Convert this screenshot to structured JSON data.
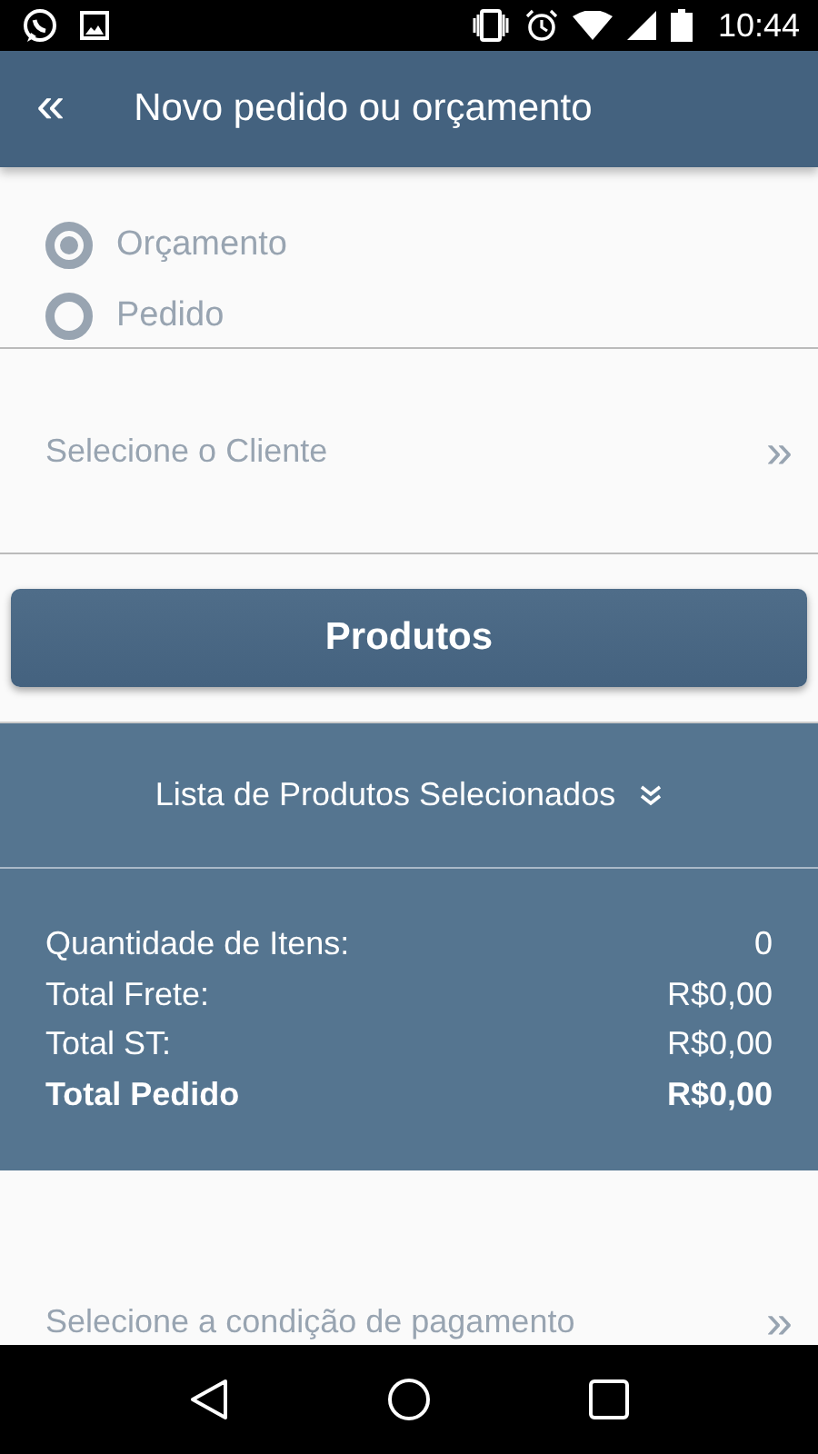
{
  "status_bar": {
    "time": "10:44"
  },
  "app_bar": {
    "back": "«",
    "title": "Novo pedido ou orçamento"
  },
  "order_type": [
    {
      "label": "Orçamento",
      "selected": true
    },
    {
      "label": "Pedido",
      "selected": false
    }
  ],
  "client_select": {
    "placeholder": "Selecione o Cliente",
    "arrow": "»"
  },
  "products_button": "Produtos",
  "selected_list": {
    "label": "Lista de Produtos Selecionados"
  },
  "totals": [
    {
      "label": "Quantidade de Itens:",
      "value": "0",
      "bold": false
    },
    {
      "label": "Total Frete:",
      "value": "R$0,00",
      "bold": false
    },
    {
      "label": "Total ST:",
      "value": "R$0,00",
      "bold": false
    },
    {
      "label": "Total Pedido",
      "value": "R$0,00",
      "bold": true
    }
  ],
  "payment_select": {
    "placeholder": "Selecione a condição de pagamento",
    "arrow": "»"
  }
}
